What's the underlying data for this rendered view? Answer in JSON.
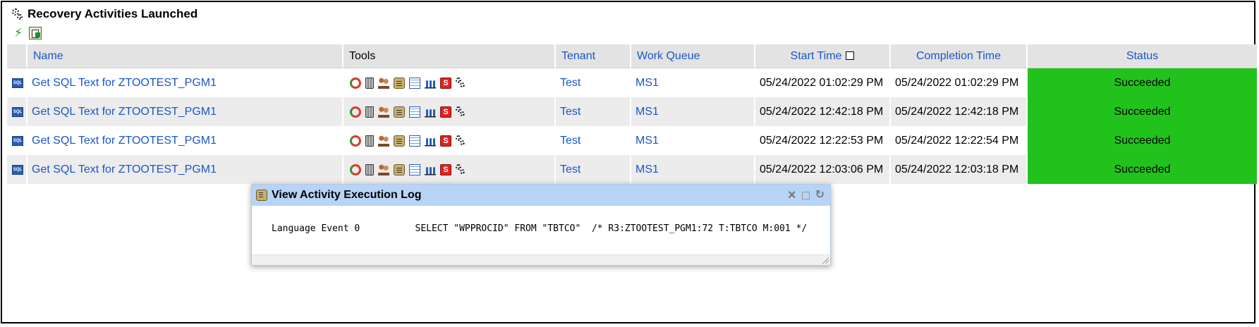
{
  "panel": {
    "title": "Recovery Activities Launched"
  },
  "toolbar": {
    "icons": [
      "refresh-icon",
      "export-icon"
    ]
  },
  "table": {
    "columns": {
      "name": "Name",
      "tools": "Tools",
      "tenant": "Tenant",
      "work_queue": "Work Queue",
      "start_time": "Start Time",
      "completion_time": "Completion Time",
      "status": "Status"
    },
    "tool_icons": [
      "recover-icon",
      "trash-icon",
      "users-icon",
      "log-scroll-icon",
      "grid-icon",
      "chart-icon",
      "stop-icon",
      "gears-icon"
    ],
    "stop_glyph": "S",
    "row_icon_text": "SQL",
    "rows": [
      {
        "name": "Get SQL Text for ZTOOTEST_PGM1",
        "tenant": "Test",
        "work_queue": "MS1",
        "start_time": "05/24/2022 01:02:29 PM",
        "completion_time": "05/24/2022 01:02:29 PM",
        "status": "Succeeded"
      },
      {
        "name": "Get SQL Text for ZTOOTEST_PGM1",
        "tenant": "Test",
        "work_queue": "MS1",
        "start_time": "05/24/2022 12:42:18 PM",
        "completion_time": "05/24/2022 12:42:18 PM",
        "status": "Succeeded"
      },
      {
        "name": "Get SQL Text for ZTOOTEST_PGM1",
        "tenant": "Test",
        "work_queue": "MS1",
        "start_time": "05/24/2022 12:22:53 PM",
        "completion_time": "05/24/2022 12:22:54 PM",
        "status": "Succeeded"
      },
      {
        "name": "Get SQL Text for ZTOOTEST_PGM1",
        "tenant": "Test",
        "work_queue": "MS1",
        "start_time": "05/24/2022 12:03:06 PM",
        "completion_time": "05/24/2022 12:03:18 PM",
        "status": "Succeeded"
      }
    ]
  },
  "dialog": {
    "title": "View Activity Execution Log",
    "log_line": "Language Event 0          SELECT \"WPPROCID\" FROM \"TBTCO\"  /* R3:ZTOOTEST_PGM1:72 T:TBTCO M:001 */",
    "close_glyph": "×",
    "refresh_glyph": "↻"
  },
  "colors": {
    "status_succeeded": "#22c21c",
    "link": "#1a56c8",
    "dialog_header": "#b7d4f7",
    "header_bg": "#e3e3e3"
  }
}
